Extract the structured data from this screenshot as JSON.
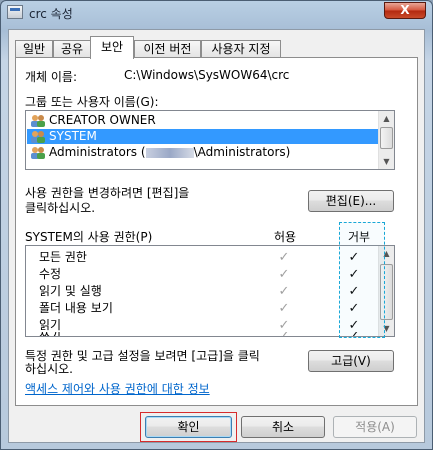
{
  "window": {
    "title": "crc 속성",
    "close_glyph": "X"
  },
  "tabs": [
    {
      "label": "일반"
    },
    {
      "label": "공유"
    },
    {
      "label": "보안"
    },
    {
      "label": "이전 버전"
    },
    {
      "label": "사용자 지정"
    }
  ],
  "security": {
    "object_name_label": "개체 이름:",
    "object_name_value": "C:\\Windows\\SysWOW64\\crc",
    "group_label": "그룹 또는 사용자 이름(G):",
    "users": [
      {
        "name": "CREATOR OWNER",
        "selected": false
      },
      {
        "name": "SYSTEM",
        "selected": true
      },
      {
        "name": "Administrators (",
        "name_suffix": "\\Administrators)",
        "selected": false
      }
    ],
    "edit_hint": "사용 권한을 변경하려면 [편집]을\n클릭하십시오.",
    "edit_button": "편집(E)...",
    "perm_label": "SYSTEM의 사용 권한(P)",
    "allow_header": "허용",
    "deny_header": "거부",
    "permissions": [
      {
        "name": "모든 권한",
        "allow": true,
        "deny": true
      },
      {
        "name": "수정",
        "allow": true,
        "deny": true
      },
      {
        "name": "읽기 및 실행",
        "allow": true,
        "deny": true
      },
      {
        "name": "폴더 내용 보기",
        "allow": true,
        "deny": true
      },
      {
        "name": "읽기",
        "allow": true,
        "deny": true
      },
      {
        "name": "쓰기",
        "allow": true,
        "deny": true
      }
    ],
    "check_glyph": "✓",
    "advanced_hint": "특정 권한 및 고급 설정을 보려면 [고급]을 클릭\n하십시오.",
    "advanced_button": "고급(V)",
    "help_link": "액세스 제어와 사용 권한에 대한 정보"
  },
  "buttons": {
    "ok": "확인",
    "cancel": "취소",
    "apply": "적용(A)"
  },
  "colors": {
    "selection": "#3399ff",
    "link": "#0066cc",
    "focus_outline": "#d62c2c",
    "deny_highlight": "#18a7d6"
  }
}
